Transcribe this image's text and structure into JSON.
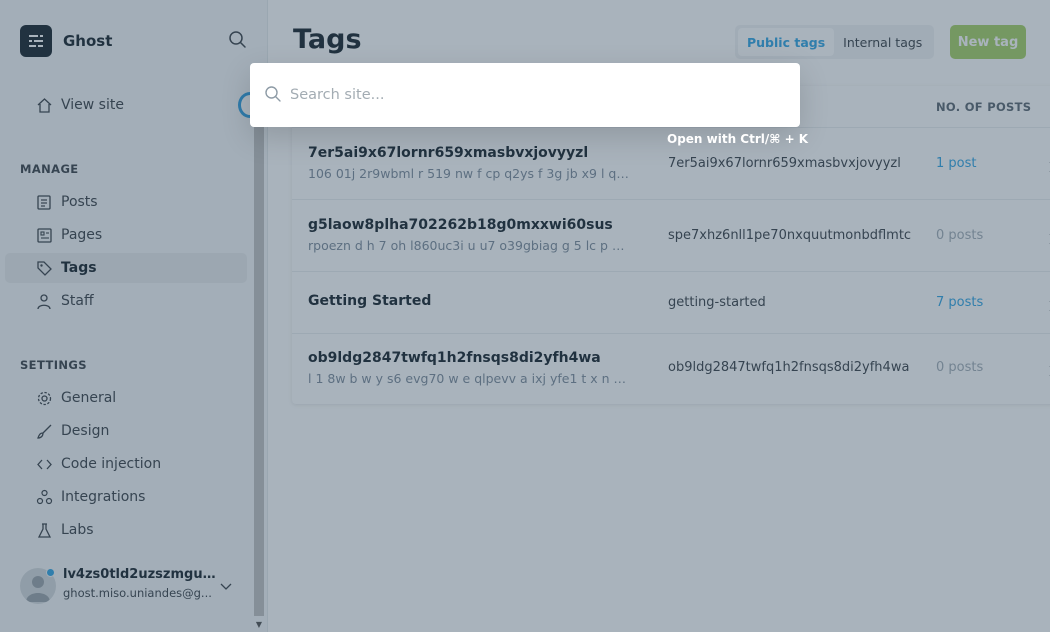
{
  "brand": {
    "name": "Ghost"
  },
  "sidebar": {
    "view_site": "View site",
    "manage_title": "MANAGE",
    "manage_items": [
      {
        "label": "Posts",
        "icon": "posts-icon"
      },
      {
        "label": "Pages",
        "icon": "pages-icon"
      },
      {
        "label": "Tags",
        "icon": "tag-icon",
        "active": true
      },
      {
        "label": "Staff",
        "icon": "staff-icon"
      }
    ],
    "settings_title": "SETTINGS",
    "settings_items": [
      {
        "label": "General",
        "icon": "gear-icon"
      },
      {
        "label": "Design",
        "icon": "brush-icon"
      },
      {
        "label": "Code injection",
        "icon": "code-icon"
      },
      {
        "label": "Integrations",
        "icon": "integrations-icon"
      },
      {
        "label": "Labs",
        "icon": "flask-icon"
      }
    ],
    "user": {
      "name": "lv4zs0tld2uzszmguul...",
      "email": "ghost.miso.uniandes@g..."
    }
  },
  "header": {
    "title": "Tags",
    "public_tags": "Public tags",
    "internal_tags": "Internal tags",
    "new_tag": "New tag"
  },
  "table": {
    "count_header": "NO. OF POSTS",
    "rows": [
      {
        "name": "7er5ai9x67lornr659xmasbvxjovyyzl",
        "description": "106 01j 2r9wbml r 519 nw f cp q2ys f 3g jb x9 l q q...",
        "slug": "7er5ai9x67lornr659xmasbvxjovyyzl",
        "count": "1 post"
      },
      {
        "name": "g5laow8plha702262b18g0mxxwi60sus",
        "description": "rpoezn d h 7 oh l860uc3i u u7 o39gbiag g 5 lc p m8...",
        "slug": "spe7xhz6nll1pe70nxquutmonbdflmtc",
        "count": "0 posts"
      },
      {
        "name": "Getting Started",
        "description": "",
        "slug": "getting-started",
        "count": "7 posts"
      },
      {
        "name": "ob9ldg2847twfq1h2fnsqs8di2yfh4wa",
        "description": "l 1 8w b w y s6 evg70 w e qlpevv a ixj yfe1 t x n wp...",
        "slug": "ob9ldg2847twfq1h2fnsqs8di2yfh4wa",
        "count": "0 posts"
      }
    ]
  },
  "search": {
    "placeholder": "Search site...",
    "hint": "Open with Ctrl/⌘ + K"
  },
  "colors": {
    "accent": "#30a4e3",
    "new_tag_button": "#a5d165",
    "overlay": "rgba(50,74,96,0.42)"
  }
}
